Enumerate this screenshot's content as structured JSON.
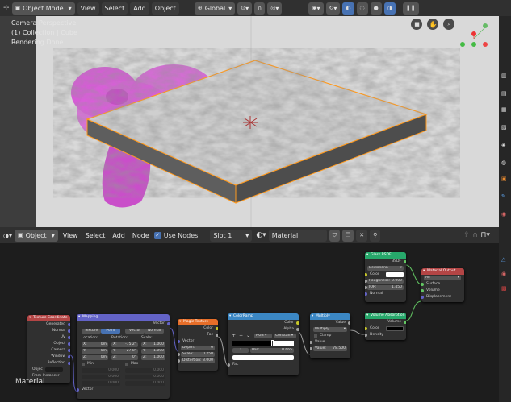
{
  "viewport_header": {
    "mode": "Object Mode",
    "menus": [
      "View",
      "Select",
      "Add",
      "Object"
    ],
    "transform": "Global"
  },
  "viewport": {
    "line1": "Camera Perspective",
    "line2": "(1) Collection | Cube",
    "line3": "Rendering Done"
  },
  "node_header": {
    "object_type": "Object",
    "menus": [
      "View",
      "Select",
      "Add",
      "Node"
    ],
    "use_nodes": "Use Nodes",
    "slot": "Slot 1",
    "material": "Material"
  },
  "editor_label": "Material",
  "nodes": {
    "texcoord": {
      "title": "Texture Coordinate",
      "outputs": [
        "Generated",
        "Normal",
        "UV",
        "Object",
        "Camera",
        "Window",
        "Reflection"
      ],
      "object_label": "Objec",
      "from_instancer": "From Instancer"
    },
    "mapping": {
      "title": "Mapping",
      "out": "Vector",
      "tabs": [
        "Texture",
        "Point",
        "Vector",
        "Normal"
      ],
      "loc_label": "Location:",
      "rot_label": "Rotation:",
      "scale_label": "Scale:",
      "rows": [
        [
          "X:",
          "0m",
          "X:",
          "-75.2°",
          "X:",
          "1.000"
        ],
        [
          "Y:",
          "0m",
          "Y:",
          "27.8°",
          "Y:",
          "1.000"
        ],
        [
          "Z:",
          "0m",
          "Z:",
          "0°",
          "Z:",
          "1.000"
        ]
      ],
      "min": "Min",
      "max": "Max",
      "minmax_vals": [
        "0.000",
        "0.000",
        "0.000",
        "0.000",
        "0.000",
        "0.000"
      ],
      "in": "Vector"
    },
    "magic": {
      "title": "Magic Texture",
      "outs": [
        "Color",
        "Fac"
      ],
      "in": "Vector",
      "depth_label": "Depth:",
      "depth": "6",
      "scale_label": "Scale:",
      "scale": "0.250",
      "dist_label": "Distortion:",
      "dist": "3.000"
    },
    "colorramp": {
      "title": "ColorRamp",
      "outs": [
        "Color",
        "Alpha"
      ],
      "mode": "RGB",
      "interp": "Constan",
      "pos_index": "1",
      "pos_label": "Pos:",
      "pos": "0.665",
      "in": "Fac"
    },
    "multiply": {
      "title": "Multiply",
      "out": "Value",
      "op": "Multiply",
      "clamp": "Clamp",
      "in1": "Value",
      "value_label": "Value:",
      "value": "78.500"
    },
    "glass": {
      "title": "Glass BSDF",
      "out": "BSDF",
      "dist": "Beckmann",
      "inputs": [
        "Color",
        "Roughness:",
        "IOR:",
        "Normal"
      ],
      "rough": "0.000",
      "ior": "1.450"
    },
    "volabs": {
      "title": "Volume Absorption",
      "out": "Volume",
      "inputs": [
        "Color",
        "Density"
      ]
    },
    "output": {
      "title": "Material Output",
      "target": "All",
      "inputs": [
        "Surface",
        "Volume",
        "Displacement"
      ]
    }
  },
  "colors": {
    "header": "#303030",
    "selected": "#4772b3",
    "vector_header": "#6363c7",
    "texture_header": "#e66e29",
    "converter_header": "#3b87c4",
    "shader_header": "#27a86b",
    "output_header": "#b34545"
  }
}
